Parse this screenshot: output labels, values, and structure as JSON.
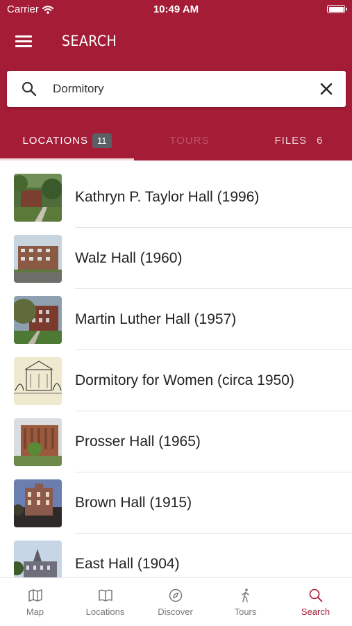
{
  "status_bar": {
    "carrier": "Carrier",
    "time": "10:49 AM"
  },
  "header": {
    "title": "SEARCH",
    "menu_icon": "hamburger-menu-icon"
  },
  "search": {
    "value": "Dormitory",
    "placeholder": "Search"
  },
  "tabs": [
    {
      "label": "LOCATIONS",
      "count": "11",
      "state": "selected"
    },
    {
      "label": "TOURS",
      "count": "",
      "state": "disabled"
    },
    {
      "label": "FILES",
      "count": "6",
      "state": "normal"
    }
  ],
  "results": [
    {
      "name": "Kathryn P. Taylor Hall (1996)"
    },
    {
      "name": "Walz Hall (1960)"
    },
    {
      "name": "Martin Luther Hall (1957)"
    },
    {
      "name": "Dormitory for Women (circa 1950)"
    },
    {
      "name": "Prosser Hall (1965)"
    },
    {
      "name": "Brown Hall (1915)"
    },
    {
      "name": "East Hall (1904)"
    }
  ],
  "bottom_nav": [
    {
      "label": "Map",
      "icon": "map-icon"
    },
    {
      "label": "Locations",
      "icon": "book-icon"
    },
    {
      "label": "Discover",
      "icon": "compass-icon"
    },
    {
      "label": "Tours",
      "icon": "walking-person-icon"
    },
    {
      "label": "Search",
      "icon": "search-icon",
      "active": true
    }
  ],
  "colors": {
    "brand": "#a51c36",
    "badge": "#5b6066",
    "separator": "#e3e3e3",
    "nav_inactive": "#777777"
  }
}
